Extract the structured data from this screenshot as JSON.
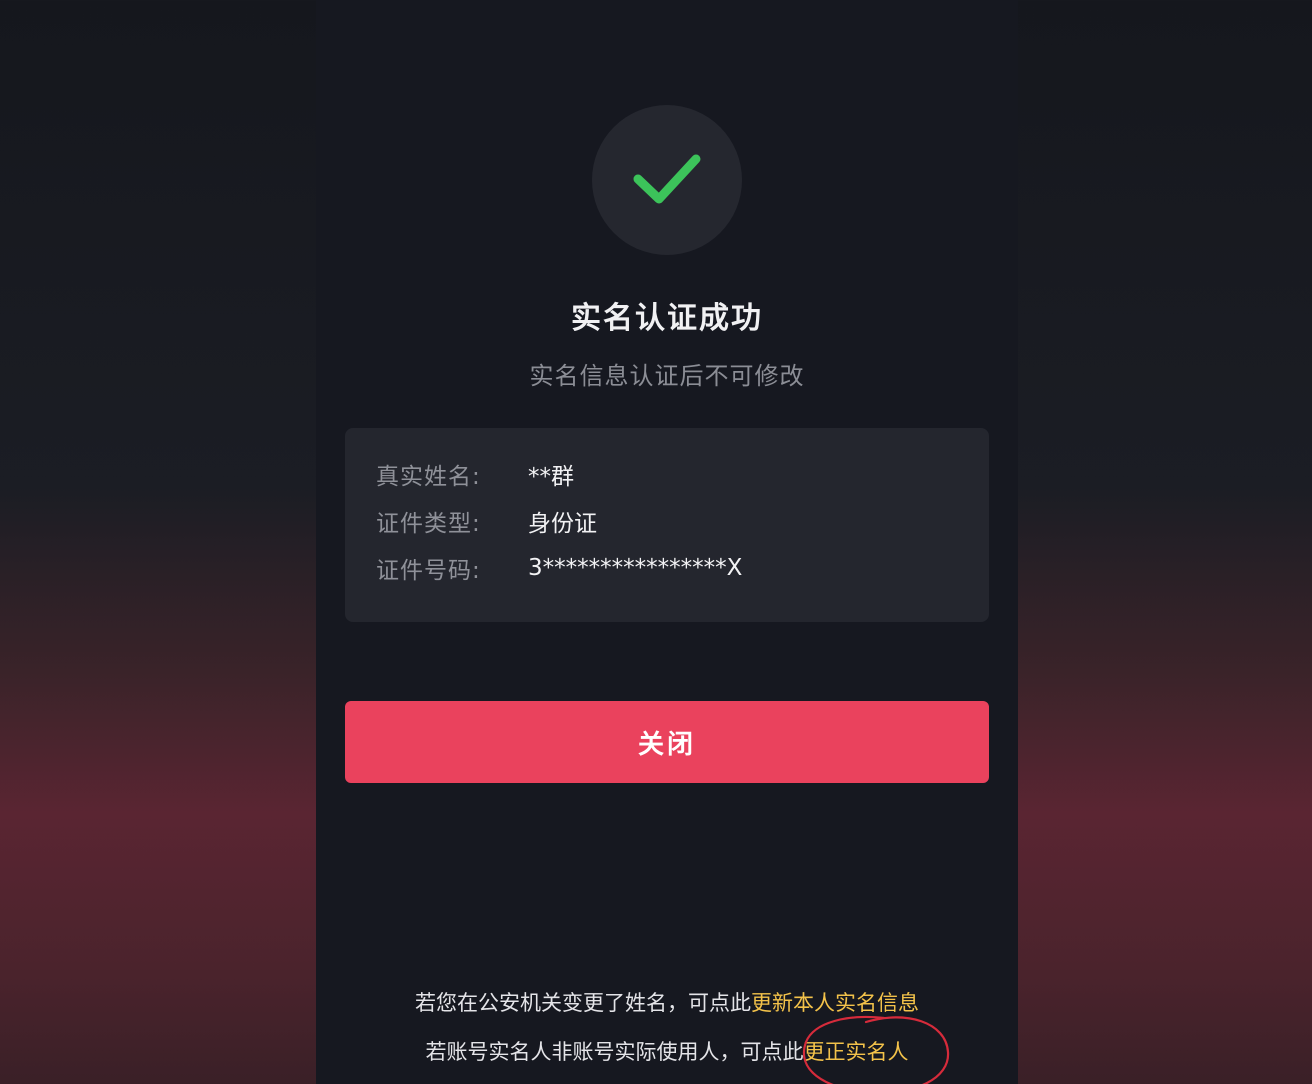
{
  "result": {
    "title": "实名认证成功",
    "subtitle": "实名信息认证后不可修改"
  },
  "info": {
    "rows": [
      {
        "label": "真实姓名:",
        "value": "**群"
      },
      {
        "label": "证件类型:",
        "value": "身份证"
      },
      {
        "label": "证件号码:",
        "value": "3****************X"
      }
    ]
  },
  "actions": {
    "close_label": "关闭"
  },
  "notes": {
    "line1_text": "若您在公安机关变更了姓名，可点此",
    "line1_link": "更新本人实名信息",
    "line2_text": "若账号实名人非账号实际使用人，可点此",
    "line2_link": "更正实名人"
  },
  "colors": {
    "success_check": "#3cc35a",
    "primary_button": "#ea425d",
    "link": "#f3c24a",
    "annotation_circle": "#d62b3b"
  },
  "icons": {
    "success": "check-icon"
  }
}
